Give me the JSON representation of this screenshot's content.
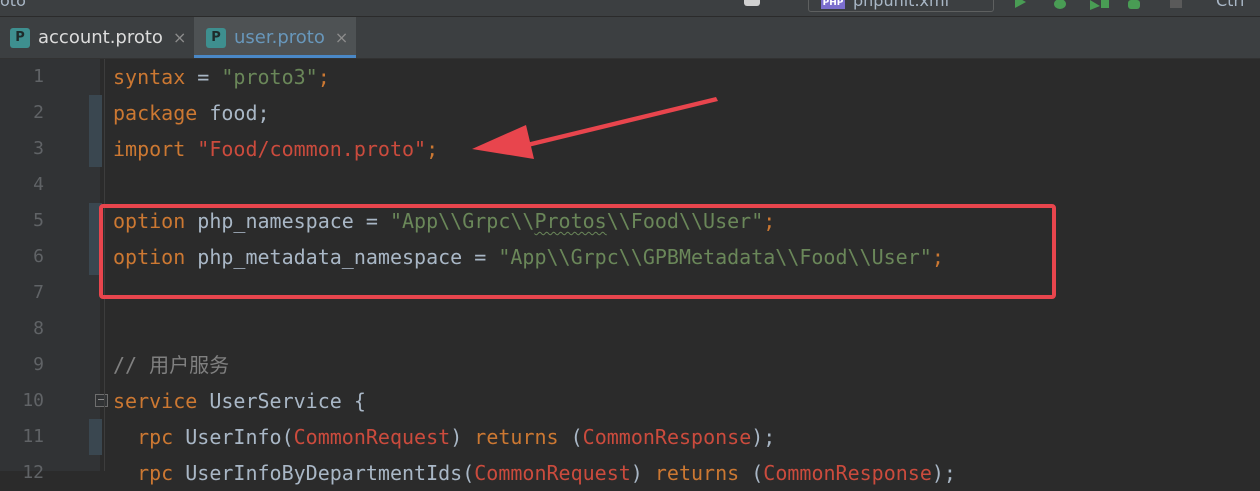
{
  "project_label": "oto",
  "run_config": {
    "badge": "PHP",
    "label": "phpunit.xml"
  },
  "topbar_right_label": "Ctrl",
  "tabs": [
    {
      "icon_letter": "P",
      "label": "account.proto",
      "close": "×",
      "active": false
    },
    {
      "icon_letter": "P",
      "label": "user.proto",
      "close": "×",
      "active": true
    }
  ],
  "line_numbers": [
    "1",
    "2",
    "3",
    "4",
    "5",
    "6",
    "7",
    "8",
    "9",
    "10",
    "11",
    "12"
  ],
  "code": {
    "l1": {
      "kw": "syntax",
      "eq": " = ",
      "str": "\"proto3\"",
      "end": ";"
    },
    "l2": {
      "kw": "package",
      "rest": " food;"
    },
    "l3": {
      "kw": "import",
      "str": " \"Food/common.proto\"",
      "end": ";"
    },
    "l5": {
      "kw": "option",
      "name": " php_namespace = ",
      "str1": "\"App\\\\Grpc\\\\",
      "sq": "Protos",
      "str2": "\\\\Food\\\\User\"",
      "end": ";"
    },
    "l6": {
      "kw": "option",
      "name": " php_metadata_namespace = ",
      "str": "\"App\\\\Grpc\\\\GPBMetadata\\\\Food\\\\User\"",
      "end": ";"
    },
    "l9": {
      "comment": "// 用户服务"
    },
    "l10": {
      "kw": "service",
      "rest": " UserService {"
    },
    "l11": {
      "indent": "  ",
      "kw1": "rpc",
      "name": " UserInfo(",
      "t1": "CommonRequest",
      "mid": ") ",
      "kw2": "returns",
      "sp": " (",
      "t2": "CommonResponse",
      "end": ");"
    },
    "l12": {
      "indent": "  ",
      "kw1": "rpc",
      "name": " UserInfoByDepartmentIds(",
      "t1": "CommonRequest",
      "mid": ") ",
      "kw2": "returns",
      "sp": " (",
      "t2": "CommonResponse",
      "end": ");"
    }
  },
  "colors": {
    "background": "#2b2b2b",
    "keyword": "#cc7832",
    "string": "#6a8759",
    "annotation_red": "#e8454d",
    "active_tab_text": "#6897bb"
  }
}
